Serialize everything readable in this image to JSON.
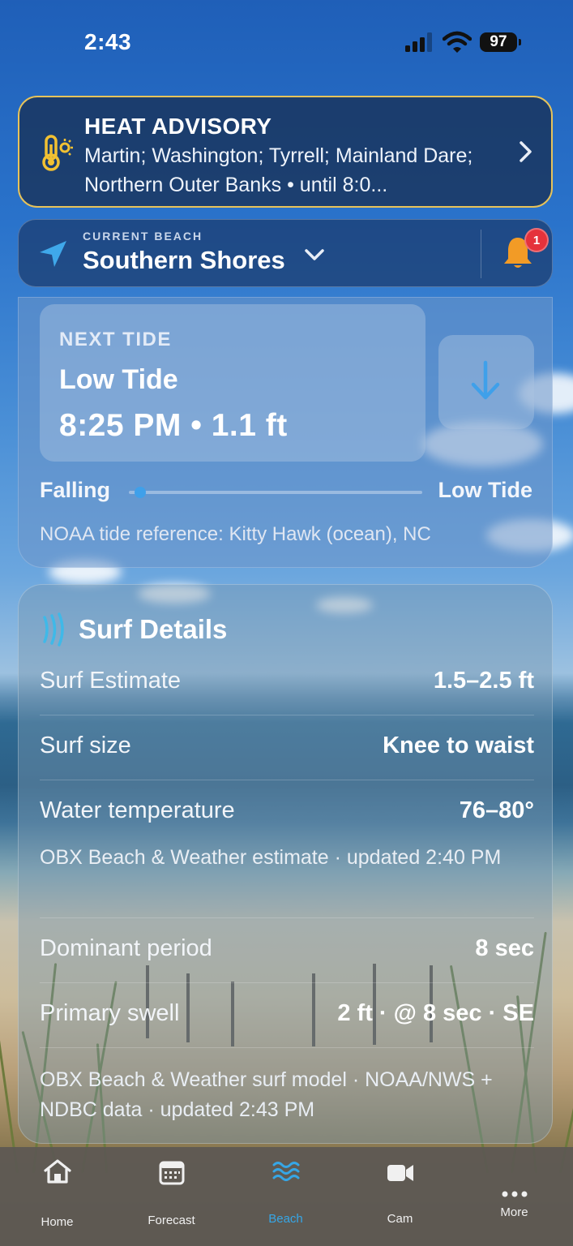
{
  "status_bar": {
    "time": "2:43",
    "battery": "97"
  },
  "advisory": {
    "title": "HEAT ADVISORY",
    "body": "Martin; Washington; Tyrrell; Mainland Dare; Northern Outer Banks • until 8:0...",
    "icon": "thermometer-sun-icon",
    "accent_color": "#e7c35a"
  },
  "beach": {
    "caption": "CURRENT BEACH",
    "name": "Southern Shores",
    "notification_count": "1",
    "bell_color": "#f29b26"
  },
  "tide": {
    "caption": "NEXT TIDE",
    "type": "Low Tide",
    "time_height": "8:25 PM • 1.1 ft",
    "trend_label": "Falling",
    "target_label": "Low Tide",
    "progress": 0.02,
    "reference": "NOAA tide reference: Kitty Hawk (ocean), NC",
    "arrow_color": "#3fa0ea"
  },
  "surf": {
    "title": "Surf Details",
    "rows": [
      {
        "label": "Surf Estimate",
        "value": "1.5–2.5 ft"
      },
      {
        "label": "Surf size",
        "value": "Knee to waist"
      },
      {
        "label": "Water temperature",
        "value": "76–80°"
      }
    ],
    "water_note": "OBX Beach & Weather estimate · updated 2:40 PM",
    "rows2": [
      {
        "label": "Dominant period",
        "value": "8 sec"
      },
      {
        "label": "Primary swell",
        "value": "2 ft · @ 8 sec · SE"
      }
    ],
    "model_note": "OBX Beach & Weather surf model · NOAA/NWS + NDBC data · updated 2:43 PM"
  },
  "tabs": [
    {
      "label": "Home",
      "icon": "home-icon",
      "active": false
    },
    {
      "label": "Forecast",
      "icon": "calendar-icon",
      "active": false
    },
    {
      "label": "Beach",
      "icon": "waves-icon",
      "active": true
    },
    {
      "label": "Cam",
      "icon": "video-camera-icon",
      "active": false
    },
    {
      "label": "More",
      "icon": "more-dots-icon",
      "active": false
    }
  ],
  "colors": {
    "active_tab": "#36a6e6",
    "inactive_tab": "#f0f0f0"
  }
}
